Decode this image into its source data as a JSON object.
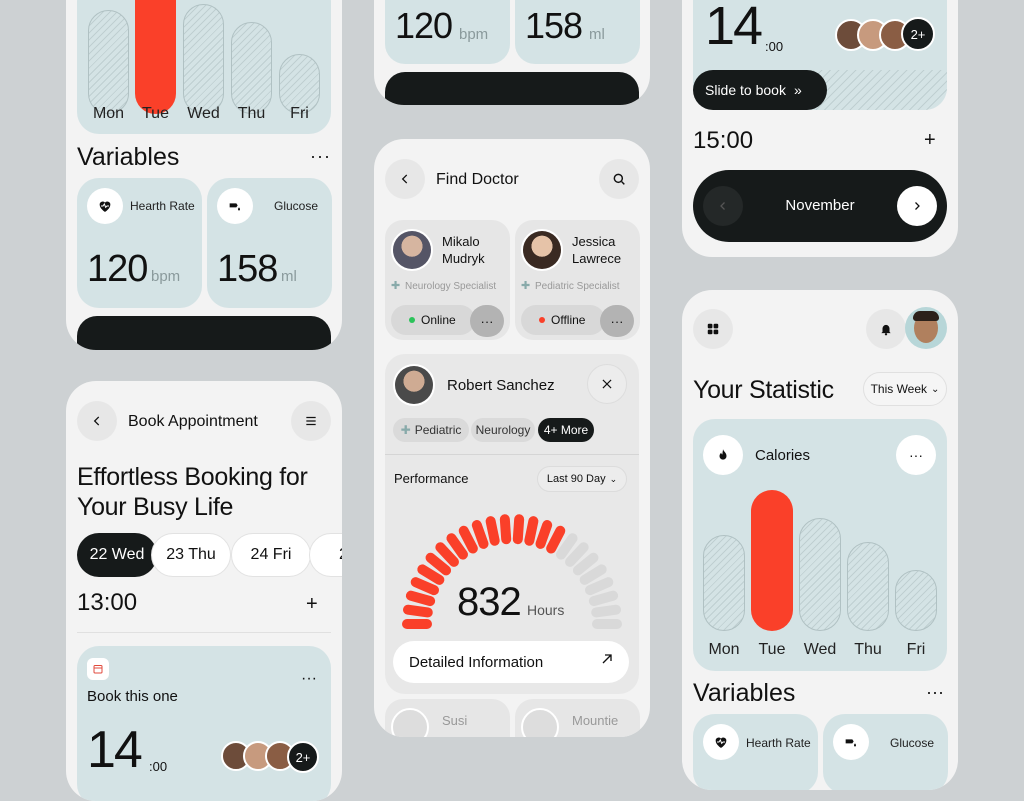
{
  "days": [
    "Mon",
    "Tue",
    "Wed",
    "Thu",
    "Fri"
  ],
  "variables_title": "Variables",
  "heart_label": "Hearth Rate",
  "glucose_label": "Glucose",
  "heart_value": "120",
  "heart_unit": "bpm",
  "glucose_value": "158",
  "glucose_unit": "ml",
  "book": {
    "title": "Book Appointment",
    "headline1": "Effortless Booking for",
    "headline2": "Your Busy Life",
    "dates": [
      "22 Wed",
      "23 Thu",
      "24 Fri",
      "2"
    ],
    "time": "13:00",
    "card_label": "Book this one",
    "card_hour": "14",
    "card_min": ":00",
    "more": "2+"
  },
  "doctor": {
    "title": "Find Doctor",
    "doctors": [
      {
        "name1": "Mikalo",
        "name2": "Mudryk",
        "spec": "Neurology Specialist",
        "status": "Online",
        "status_color": "#2bc35a"
      },
      {
        "name1": "Jessica",
        "name2": "Lawrece",
        "spec": "Pediatric Specialist",
        "status": "Offline",
        "status_color": "#fa4029"
      }
    ],
    "selected_name": "Robert Sanchez",
    "tags": [
      "Pediatric",
      "Neurology",
      "4+ More"
    ],
    "performance_label": "Performance",
    "range": "Last 90 Day",
    "hours_value": "832",
    "hours_unit": "Hours",
    "detail": "Detailed Information",
    "bottom_names": [
      "Susi",
      "Mountie"
    ],
    "gauge_fraction": 0.68
  },
  "schedule": {
    "hour": "14",
    "min": ":00",
    "more": "2+",
    "slide": "Slide to book",
    "time2": "15:00",
    "month": "November"
  },
  "stats": {
    "title": "Your Statistic",
    "range": "This Week",
    "calories": "Calories",
    "variables": "Variables"
  },
  "colors": {
    "accent": "#fa4029",
    "card": "#d4e3e5",
    "dark": "#161a1a"
  }
}
